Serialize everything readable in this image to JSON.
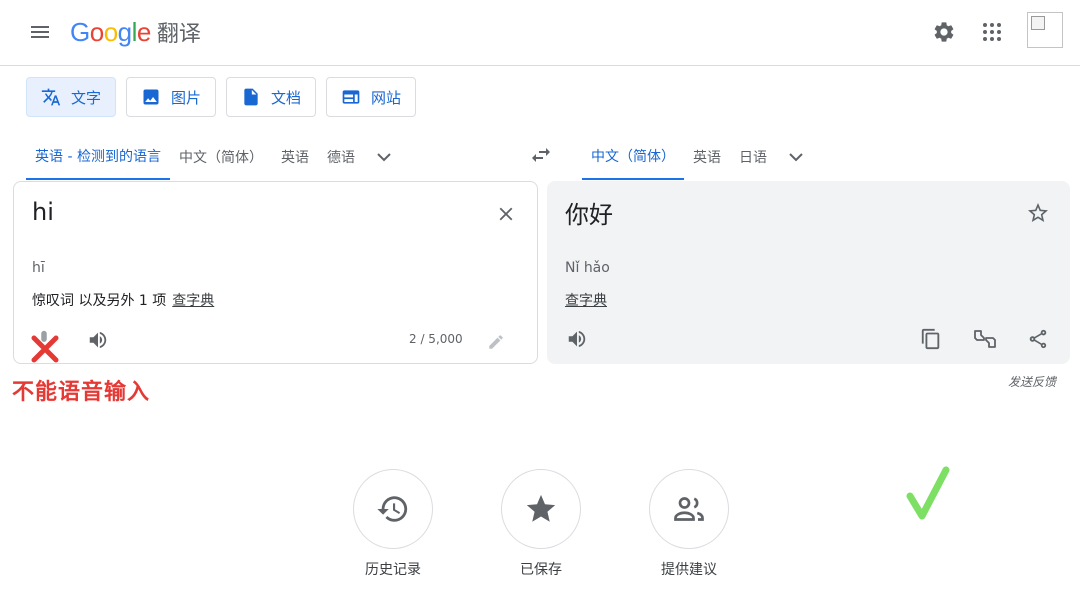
{
  "header": {
    "logo_word": [
      "G",
      "o",
      "o",
      "g",
      "l",
      "e"
    ],
    "product": "翻译"
  },
  "modes": [
    {
      "label": "文字",
      "icon": "translate-icon",
      "active": true
    },
    {
      "label": "图片",
      "icon": "image-icon",
      "active": false
    },
    {
      "label": "文档",
      "icon": "document-icon",
      "active": false
    },
    {
      "label": "网站",
      "icon": "website-icon",
      "active": false
    }
  ],
  "source_langs": [
    "英语 - 检测到的语言",
    "中文（简体）",
    "英语",
    "德语"
  ],
  "target_langs": [
    "中文（简体）",
    "英语",
    "日语"
  ],
  "source": {
    "text": "hi",
    "transliteration": "hī",
    "more_info": "惊叹词 以及另外 1 项",
    "dict_link": "查字典",
    "char_count": "2 / 5,000"
  },
  "target": {
    "text": "你好",
    "transliteration": "Nǐ hǎo",
    "dict_link": "查字典"
  },
  "feedback": "发送反馈",
  "annotation": "不能语音输入",
  "bottom": [
    {
      "label": "历史记录",
      "icon": "history-icon"
    },
    {
      "label": "已保存",
      "icon": "star-filled-icon"
    },
    {
      "label": "提供建议",
      "icon": "community-icon"
    }
  ],
  "colors": {
    "accent": "#1a73e8",
    "annotation_red": "#e53935",
    "check_green": "#7ddf64"
  }
}
